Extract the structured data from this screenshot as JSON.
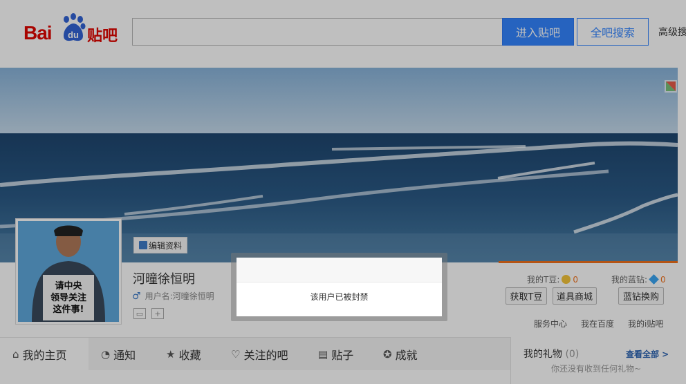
{
  "header": {
    "logo_bai": "Bai",
    "logo_du": "du",
    "logo_tieba": "贴吧",
    "search_value": "",
    "enter_button": "进入贴吧",
    "all_search_button": "全吧搜索",
    "advanced_link": "高级搜"
  },
  "profile": {
    "edit_button": "编辑资料",
    "display_name": "河曈徐恒明",
    "username_label": "用户名:河曈徐恒明",
    "avatar_sign_lines": [
      "请中央",
      "领导关注",
      "这件事!"
    ],
    "badge_plus": "+",
    "tdou_label": "我的T豆:",
    "tdou_value": "0",
    "diamond_label": "我的蓝钻:",
    "diamond_value": "0",
    "buttons": {
      "get_tdou": "获取T豆",
      "prop_store": "道具商城",
      "diamond_exchange": "蓝钻换购"
    },
    "links": {
      "service": "服务中心",
      "in_baidu": "我在百度",
      "my_tieba": "我的i贴吧"
    }
  },
  "tabs": [
    {
      "label": "我的主页",
      "icon": "home-icon"
    },
    {
      "label": "通知",
      "icon": "bell-icon"
    },
    {
      "label": "收藏",
      "icon": "star-icon"
    },
    {
      "label": "关注的吧",
      "icon": "heart-icon"
    },
    {
      "label": "贴子",
      "icon": "document-icon"
    },
    {
      "label": "成就",
      "icon": "achievement-icon"
    }
  ],
  "gifts": {
    "title": "我的礼物",
    "count": "(0)",
    "more": "查看全部 >",
    "empty_text": "你还没有收到任何礼物~"
  },
  "modal": {
    "message": "该用户已被封禁"
  },
  "colors": {
    "brand_red": "#e10601",
    "brand_blue": "#3385ff",
    "accent_orange": "#f1711b"
  }
}
